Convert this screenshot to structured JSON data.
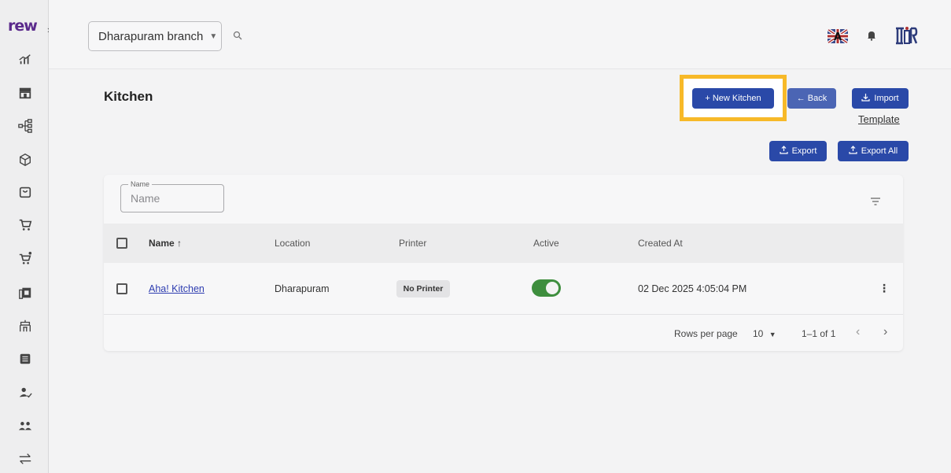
{
  "sidebar": {
    "logo": "rew",
    "expand_icon": "›",
    "items": [
      {
        "icon": "chart-icon"
      },
      {
        "icon": "store-icon"
      },
      {
        "icon": "hierarchy-icon"
      },
      {
        "icon": "box-icon"
      },
      {
        "icon": "bag-icon"
      },
      {
        "icon": "cart-icon"
      },
      {
        "icon": "cart-plus-icon"
      },
      {
        "icon": "copy-icon"
      },
      {
        "icon": "table-icon"
      },
      {
        "icon": "list-icon"
      },
      {
        "icon": "user-check-icon"
      },
      {
        "icon": "group-icon"
      },
      {
        "icon": "transfer-icon"
      }
    ]
  },
  "header": {
    "branch": "Dharapuram branch",
    "flag_label": "A"
  },
  "page": {
    "title": "Kitchen",
    "new_button": "+ New Kitchen",
    "back_button": "← Back",
    "import_button": "Import",
    "template_link": "Template",
    "export_button": "Export",
    "export_all_button": "Export All"
  },
  "filter": {
    "label": "Name",
    "placeholder": "Name"
  },
  "table": {
    "columns": [
      "Name ↑",
      "Location",
      "Printer",
      "Active",
      "Created At"
    ],
    "rows": [
      {
        "name": "Aha! Kitchen",
        "location": "Dharapuram",
        "printer": "No Printer",
        "active": true,
        "created_at": "02 Dec 2025 4:05:04 PM"
      }
    ]
  },
  "pagination": {
    "rows_label": "Rows per page",
    "rows_value": "10",
    "range": "1–1 of 1",
    "prev": "‹",
    "next": "›"
  },
  "colors": {
    "primary": "#2a49a8",
    "highlight": "#f7b928",
    "toggle_on": "#3e8e3e"
  }
}
